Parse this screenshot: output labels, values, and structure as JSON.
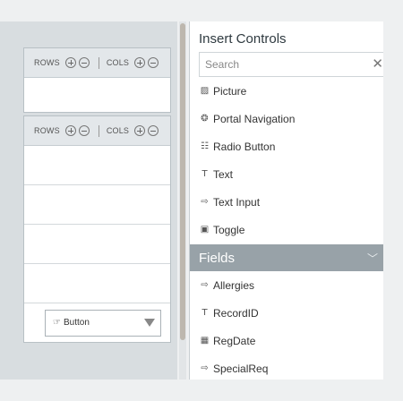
{
  "grid_top": {
    "rows_label": "ROWS",
    "cols_label": "COLS"
  },
  "grid_bottom": {
    "rows_label": "ROWS",
    "cols_label": "COLS",
    "button_label": "Button"
  },
  "panel": {
    "title": "Insert Controls",
    "search_placeholder": "Search",
    "controls": [
      {
        "label": "Picture",
        "icon": "picture-icon"
      },
      {
        "label": "Portal Navigation",
        "icon": "portal-navigation-icon"
      },
      {
        "label": "Radio Button",
        "icon": "radio-button-icon"
      },
      {
        "label": "Text",
        "icon": "text-icon"
      },
      {
        "label": "Text Input",
        "icon": "text-input-icon"
      },
      {
        "label": "Toggle",
        "icon": "toggle-icon"
      }
    ],
    "fields_section": "Fields",
    "fields": [
      {
        "label": "Allergies",
        "icon": "text-input-icon"
      },
      {
        "label": "RecordID",
        "icon": "text-icon"
      },
      {
        "label": "RegDate",
        "icon": "calendar-icon"
      },
      {
        "label": "SpecialReq",
        "icon": "text-input-icon"
      }
    ]
  }
}
